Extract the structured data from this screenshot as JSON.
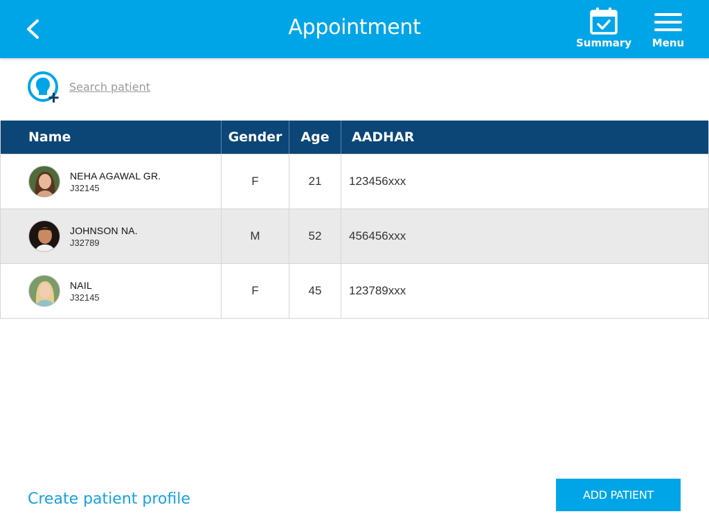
{
  "header": {
    "title": "Appointment",
    "back_icon": "chevron-left-icon",
    "summary_label": "Summary",
    "summary_icon": "calendar-check-icon",
    "menu_label": "Menu",
    "menu_icon": "hamburger-icon",
    "background_color": "#00a5e8"
  },
  "search": {
    "placeholder": "Search patient",
    "icon": "add-patient-icon",
    "value": ""
  },
  "table": {
    "columns": [
      "Name",
      "Gender",
      "Age",
      "AADHAR"
    ],
    "header_color": "#0b4677",
    "rows": [
      {
        "name": "NEHA AGAWAL GR.",
        "id": "J32145",
        "gender": "F",
        "age": "21",
        "aadhar": "123456xxx"
      },
      {
        "name": "JOHNSON NA.",
        "id": "J32789",
        "gender": "M",
        "age": "52",
        "aadhar": "456456xxx"
      },
      {
        "name": "NAIL",
        "id": "J32145",
        "gender": "F",
        "age": "45",
        "aadhar": "123789xxx"
      }
    ]
  },
  "footer": {
    "create_profile_label": "Create patient profile",
    "add_patient_label": "ADD PATIENT",
    "accent_color": "#00a5e8"
  }
}
